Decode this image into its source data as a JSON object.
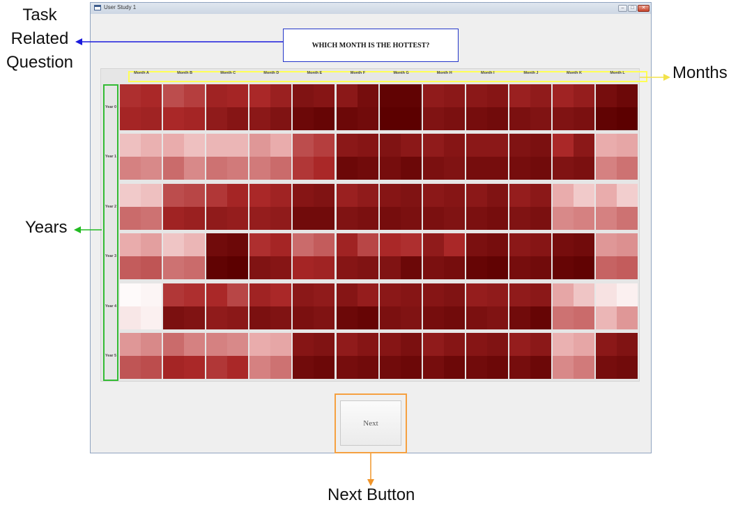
{
  "window": {
    "title": "User Study 1",
    "controls": [
      "minimize",
      "maximize",
      "close"
    ]
  },
  "question": "WHICH MONTH IS THE HOTTEST?",
  "chart_data": {
    "type": "heatmap",
    "title": "",
    "months": [
      "Month A",
      "Month B",
      "Month C",
      "Month D",
      "Month E",
      "Month F",
      "Month G",
      "Month H",
      "Month I",
      "Month J",
      "Month K",
      "Month L"
    ],
    "years": [
      "Year 0",
      "Year 1",
      "Year 2",
      "Year 3",
      "Year 4",
      "Year 5"
    ],
    "sub_cells_per_cell": 4,
    "intensity_scale": "0 = white (cool) to 1 = dark red (hot)",
    "colors": {
      "low": "#ffffff",
      "high": "#5e0000"
    },
    "values": [
      [
        [
          0.68,
          0.7,
          0.72,
          0.74
        ],
        [
          0.6,
          0.64,
          0.7,
          0.72
        ],
        [
          0.74,
          0.72,
          0.8,
          0.84
        ],
        [
          0.7,
          0.76,
          0.82,
          0.86
        ],
        [
          0.86,
          0.84,
          0.94,
          0.96
        ],
        [
          0.82,
          0.9,
          0.94,
          0.92
        ],
        [
          0.98,
          0.98,
          1.0,
          1.0
        ],
        [
          0.8,
          0.82,
          0.86,
          0.88
        ],
        [
          0.82,
          0.84,
          0.9,
          0.92
        ],
        [
          0.76,
          0.8,
          0.88,
          0.86
        ],
        [
          0.74,
          0.78,
          0.86,
          0.88
        ],
        [
          0.9,
          0.94,
          0.98,
          1.0
        ]
      ],
      [
        [
          0.26,
          0.32,
          0.46,
          0.44
        ],
        [
          0.34,
          0.26,
          0.52,
          0.44
        ],
        [
          0.3,
          0.3,
          0.5,
          0.48
        ],
        [
          0.4,
          0.34,
          0.48,
          0.52
        ],
        [
          0.6,
          0.64,
          0.66,
          0.7
        ],
        [
          0.82,
          0.84,
          0.94,
          0.92
        ],
        [
          0.86,
          0.82,
          0.9,
          0.94
        ],
        [
          0.8,
          0.84,
          0.88,
          0.86
        ],
        [
          0.82,
          0.82,
          0.9,
          0.9
        ],
        [
          0.86,
          0.88,
          0.9,
          0.92
        ],
        [
          0.7,
          0.82,
          0.86,
          0.88
        ],
        [
          0.34,
          0.36,
          0.46,
          0.5
        ]
      ],
      [
        [
          0.22,
          0.26,
          0.52,
          0.5
        ],
        [
          0.6,
          0.62,
          0.74,
          0.76
        ],
        [
          0.66,
          0.72,
          0.8,
          0.78
        ],
        [
          0.7,
          0.74,
          0.78,
          0.8
        ],
        [
          0.84,
          0.86,
          0.92,
          0.92
        ],
        [
          0.76,
          0.8,
          0.86,
          0.88
        ],
        [
          0.84,
          0.86,
          0.9,
          0.88
        ],
        [
          0.82,
          0.84,
          0.88,
          0.86
        ],
        [
          0.82,
          0.86,
          0.88,
          0.9
        ],
        [
          0.78,
          0.82,
          0.86,
          0.88
        ],
        [
          0.34,
          0.22,
          0.44,
          0.46
        ],
        [
          0.34,
          0.2,
          0.46,
          0.5
        ]
      ],
      [
        [
          0.34,
          0.38,
          0.56,
          0.58
        ],
        [
          0.24,
          0.3,
          0.5,
          0.52
        ],
        [
          0.92,
          0.94,
          0.98,
          1.0
        ],
        [
          0.68,
          0.72,
          0.86,
          0.84
        ],
        [
          0.52,
          0.56,
          0.72,
          0.74
        ],
        [
          0.74,
          0.62,
          0.84,
          0.86
        ],
        [
          0.7,
          0.68,
          0.86,
          0.94
        ],
        [
          0.8,
          0.7,
          0.88,
          0.9
        ],
        [
          0.88,
          0.9,
          0.96,
          0.98
        ],
        [
          0.82,
          0.84,
          0.9,
          0.92
        ],
        [
          0.9,
          0.92,
          0.96,
          0.98
        ],
        [
          0.4,
          0.42,
          0.54,
          0.56
        ]
      ],
      [
        [
          0.02,
          0.04,
          0.1,
          0.06
        ],
        [
          0.66,
          0.68,
          0.88,
          0.86
        ],
        [
          0.7,
          0.62,
          0.8,
          0.82
        ],
        [
          0.74,
          0.7,
          0.88,
          0.86
        ],
        [
          0.82,
          0.8,
          0.88,
          0.86
        ],
        [
          0.84,
          0.78,
          0.94,
          0.96
        ],
        [
          0.82,
          0.84,
          0.88,
          0.86
        ],
        [
          0.84,
          0.86,
          0.9,
          0.92
        ],
        [
          0.78,
          0.8,
          0.88,
          0.86
        ],
        [
          0.8,
          0.82,
          0.92,
          0.96
        ],
        [
          0.36,
          0.24,
          0.5,
          0.52
        ],
        [
          0.12,
          0.06,
          0.3,
          0.4
        ]
      ],
      [
        [
          0.4,
          0.44,
          0.58,
          0.6
        ],
        [
          0.52,
          0.46,
          0.72,
          0.7
        ],
        [
          0.46,
          0.44,
          0.66,
          0.7
        ],
        [
          0.34,
          0.36,
          0.46,
          0.5
        ],
        [
          0.84,
          0.86,
          0.92,
          0.94
        ],
        [
          0.8,
          0.84,
          0.9,
          0.92
        ],
        [
          0.84,
          0.88,
          0.92,
          0.94
        ],
        [
          0.8,
          0.84,
          0.9,
          0.94
        ],
        [
          0.84,
          0.86,
          0.92,
          0.94
        ],
        [
          0.78,
          0.82,
          0.9,
          0.94
        ],
        [
          0.32,
          0.36,
          0.44,
          0.48
        ],
        [
          0.82,
          0.86,
          0.9,
          0.92
        ]
      ]
    ]
  },
  "next_button": {
    "label": "Next"
  },
  "annotations": {
    "task_question": [
      "Task",
      "Related",
      "Question"
    ],
    "years": "Years",
    "months": "Months",
    "next_button": "Next Button",
    "colors": {
      "task": "#1a1adc",
      "years": "#22bb22",
      "months": "#f2e24a",
      "next": "#f0952a"
    }
  }
}
